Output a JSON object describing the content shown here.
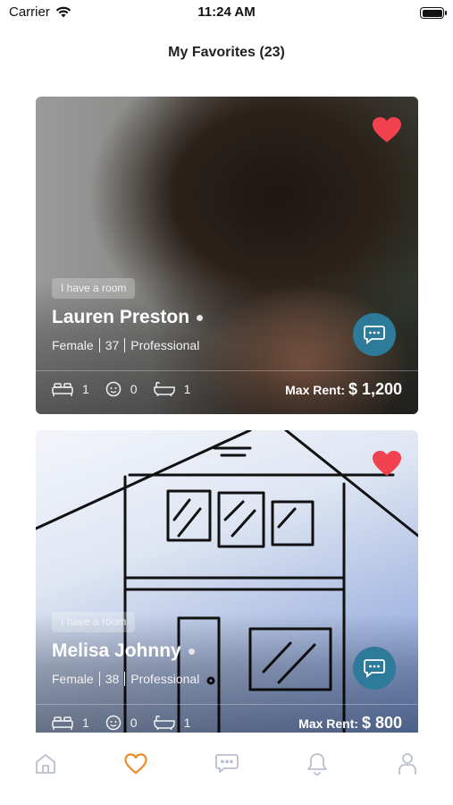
{
  "status_bar": {
    "carrier": "Carrier",
    "time": "11:24 AM"
  },
  "header": {
    "title": "My Favorites (23)"
  },
  "colors": {
    "accent": "#f08a24",
    "heart": "#f2414f",
    "chat": "#2e7a9a",
    "tab_inactive": "#b9bfd0"
  },
  "favorites": [
    {
      "badge": "I have a room",
      "name": "Lauren Preston",
      "gender": "Female",
      "age": "37",
      "occupation": "Professional",
      "beds": "1",
      "kids": "0",
      "baths": "1",
      "rent_label": "Max Rent:",
      "rent_value": "$ 1,200"
    },
    {
      "badge": "I have a room",
      "name": "Melisa Johnny",
      "gender": "Female",
      "age": "38",
      "occupation": "Professional",
      "beds": "1",
      "kids": "0",
      "baths": "1",
      "rent_label": "Max Rent:",
      "rent_value": "$ 800"
    }
  ],
  "tabbar": {
    "items": [
      {
        "icon": "home-icon",
        "active": false
      },
      {
        "icon": "heart-icon",
        "active": true
      },
      {
        "icon": "chat-icon",
        "active": false
      },
      {
        "icon": "bell-icon",
        "active": false
      },
      {
        "icon": "profile-icon",
        "active": false
      }
    ]
  }
}
